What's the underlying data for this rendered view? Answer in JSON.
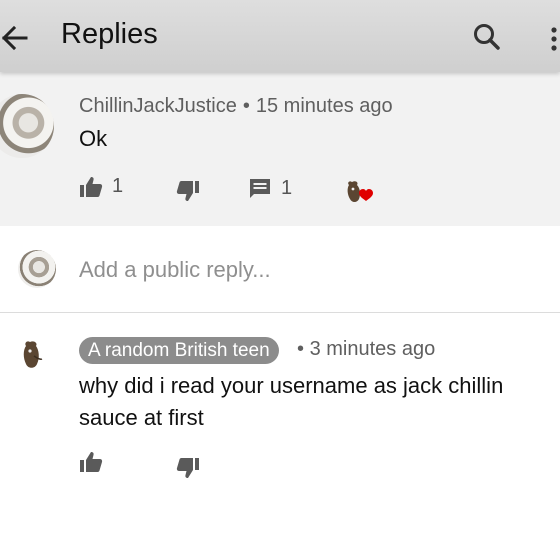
{
  "appbar": {
    "title": "Replies"
  },
  "icons": {
    "back": "arrow-left-icon",
    "search": "search-icon",
    "more": "more-vert-icon",
    "like": "thumbs-up-icon",
    "dislike": "thumbs-down-icon",
    "reply": "comment-icon",
    "creator_heart": "creator-heart-icon"
  },
  "parent_comment": {
    "author": "ChillinJackJustice",
    "separator": "•",
    "time": "15 minutes ago",
    "text": "Ok",
    "like_count": "1",
    "reply_count": "1"
  },
  "add_reply": {
    "placeholder": "Add a public reply..."
  },
  "reply": {
    "author": "A random British teen",
    "separator": "•",
    "time": "3 minutes ago",
    "text": "why did i read your username as jack chillin sauce at first"
  },
  "colors": {
    "appbar": "#d6d6d6",
    "parent_bg": "#f2f2f2",
    "heart": "#e00000",
    "author_chip": "#8c8c8c",
    "icon": "#5a5a5a"
  }
}
